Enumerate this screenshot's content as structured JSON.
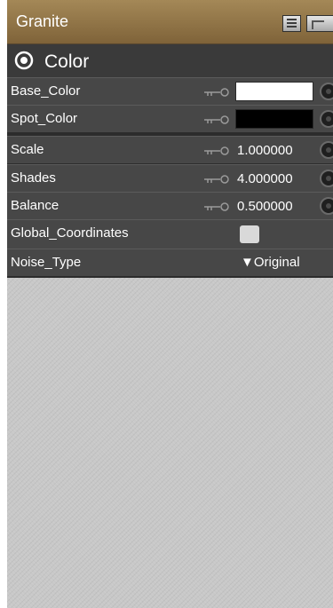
{
  "panel": {
    "title": "Granite"
  },
  "section": {
    "label": "Color",
    "icon": "eye-icon"
  },
  "properties": [
    {
      "label": "Base_Color",
      "type": "color",
      "color": "#ffffff",
      "icon": "key-icon"
    },
    {
      "label": "Spot_Color",
      "type": "color",
      "color": "#000000",
      "icon": "key-icon"
    },
    {
      "label": "Scale",
      "type": "number",
      "value": "1.000000",
      "icon": "key-icon"
    },
    {
      "label": "Shades",
      "type": "number",
      "value": "4.000000",
      "icon": "key-icon"
    },
    {
      "label": "Balance",
      "type": "number",
      "value": "0.500000",
      "icon": "key-icon"
    },
    {
      "label": "Global_Coordinates",
      "type": "checkbox",
      "checked": false
    },
    {
      "label": "Noise_Type",
      "type": "dropdown",
      "value": "▼Original"
    }
  ],
  "colors": {
    "titlebar": "#8f744a",
    "panel_bg": "#2c2c2c",
    "row_bg": "#474747",
    "empty_area": "#c8c8c8"
  }
}
